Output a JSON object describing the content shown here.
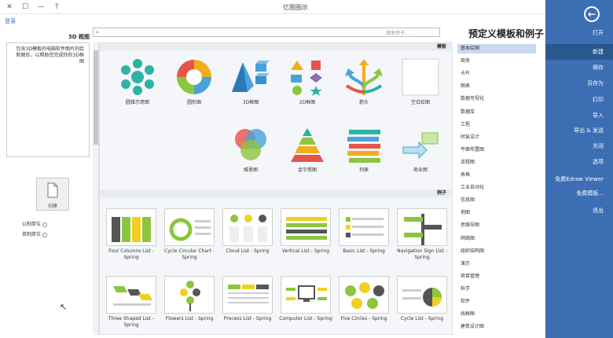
{
  "titlebar": {
    "title": "亿图图示",
    "help": "?",
    "minimize": "—",
    "maximize": "☐",
    "close": "✕"
  },
  "login": "登录",
  "sidebar": {
    "back": "←",
    "items": [
      {
        "label": "打开",
        "active": false
      },
      {
        "label": "新建",
        "active": true
      },
      {
        "label": "保存",
        "active": false
      },
      {
        "label": "另存为",
        "active": false
      },
      {
        "label": "打印",
        "active": false
      },
      {
        "label": "导入",
        "active": false
      },
      {
        "label": "导出 & 发送",
        "active": false
      },
      {
        "label": "关闭",
        "active": false
      },
      {
        "label": "选项",
        "active": false
      },
      {
        "label": "免费Edraw Viewer",
        "active": false
      },
      {
        "label": "免费模板...",
        "active": false
      },
      {
        "label": "退出",
        "active": false
      }
    ]
  },
  "page_title": "预定义模板和例子",
  "search": {
    "placeholder": "搜索例子..."
  },
  "categories": [
    "基本绘图",
    "商务",
    "卡片",
    "图表",
    "数据可视化",
    "数据库",
    "工程",
    "时装设计",
    "平面布置图",
    "流程图",
    "表格",
    "工业自动化",
    "信息图",
    "地图",
    "思维导图",
    "网络图",
    "组织结构图",
    "演示",
    "项目管理",
    "科学",
    "软件",
    "线框图",
    "建筑设计图"
  ],
  "sections": {
    "templates": "模板",
    "examples": "例子"
  },
  "templates": [
    {
      "label": "空白绘图"
    },
    {
      "label": "箭头"
    },
    {
      "label": "2D框图"
    },
    {
      "label": "3D框图"
    },
    {
      "label": "圆形图"
    },
    {
      "label": "圆锥示意图"
    },
    {
      "label": "商业图"
    },
    {
      "label": "列表"
    },
    {
      "label": "金字塔图"
    },
    {
      "label": "维恩图"
    }
  ],
  "examples": [
    {
      "label": "Navigation Sign List - Spring"
    },
    {
      "label": "Basic List - Spring"
    },
    {
      "label": "Vertical List - Spring"
    },
    {
      "label": "Cloud List - Spring"
    },
    {
      "label": "Cycle Circular Chart - Spring"
    },
    {
      "label": "Four Columns List - Spring"
    },
    {
      "label": "Cycle List - Spring"
    },
    {
      "label": "Five Circles - Spring"
    },
    {
      "label": "Computer List - Spring"
    },
    {
      "label": "Process List - Spring"
    },
    {
      "label": "Flowers List - Spring"
    },
    {
      "label": "Three Shaped List - Spring"
    }
  ],
  "desc_panel": {
    "title": "3D 框图",
    "text": "包含3D模板的电脑软件图片的绘制图形，以帮助您完成你的3D框图"
  },
  "create_button": "创建",
  "radios": [
    {
      "label": "公制单位"
    },
    {
      "label": "英制单位"
    }
  ],
  "colors": {
    "sidebar": "#3c6eb4",
    "sidebar_active": "#2b578f",
    "category_active": "#c9d9ee",
    "accent_green": "#8cc63f",
    "accent_blue": "#4a90c8"
  }
}
